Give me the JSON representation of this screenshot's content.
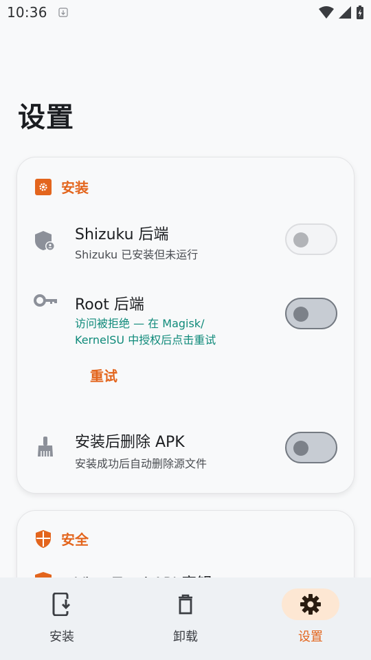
{
  "status_bar": {
    "time": "10:36"
  },
  "page": {
    "title": "设置"
  },
  "install_section": {
    "label": "安装",
    "rows": [
      {
        "title": "Shizuku 后端",
        "subtitle": "Shizuku 已安装但未运行",
        "icon": "shield-user-icon",
        "enabled": false
      },
      {
        "title": "Root 后端",
        "subtitle": "访问被拒绝 — 在 Magisk/ KernelSU 中授权后点击重试",
        "icon": "key-icon",
        "enabled": false,
        "action": "重试"
      },
      {
        "title": "安装后删除 APK",
        "subtitle": "安装成功后自动删除源文件",
        "icon": "broom-icon",
        "enabled": false
      }
    ]
  },
  "security_section": {
    "label": "安全",
    "rows": [
      {
        "title": "VirusTotal API 密钥",
        "icon": "shield-icon"
      }
    ]
  },
  "bottom_nav": {
    "items": [
      {
        "label": "安装",
        "icon": "phone-download-icon",
        "active": false
      },
      {
        "label": "卸载",
        "icon": "trash-icon",
        "active": false
      },
      {
        "label": "设置",
        "icon": "gear-icon",
        "active": true
      }
    ]
  },
  "colors": {
    "accent": "#e3651d",
    "error_text": "#0f8a7a",
    "active_nav_pill": "#fde7d3"
  }
}
